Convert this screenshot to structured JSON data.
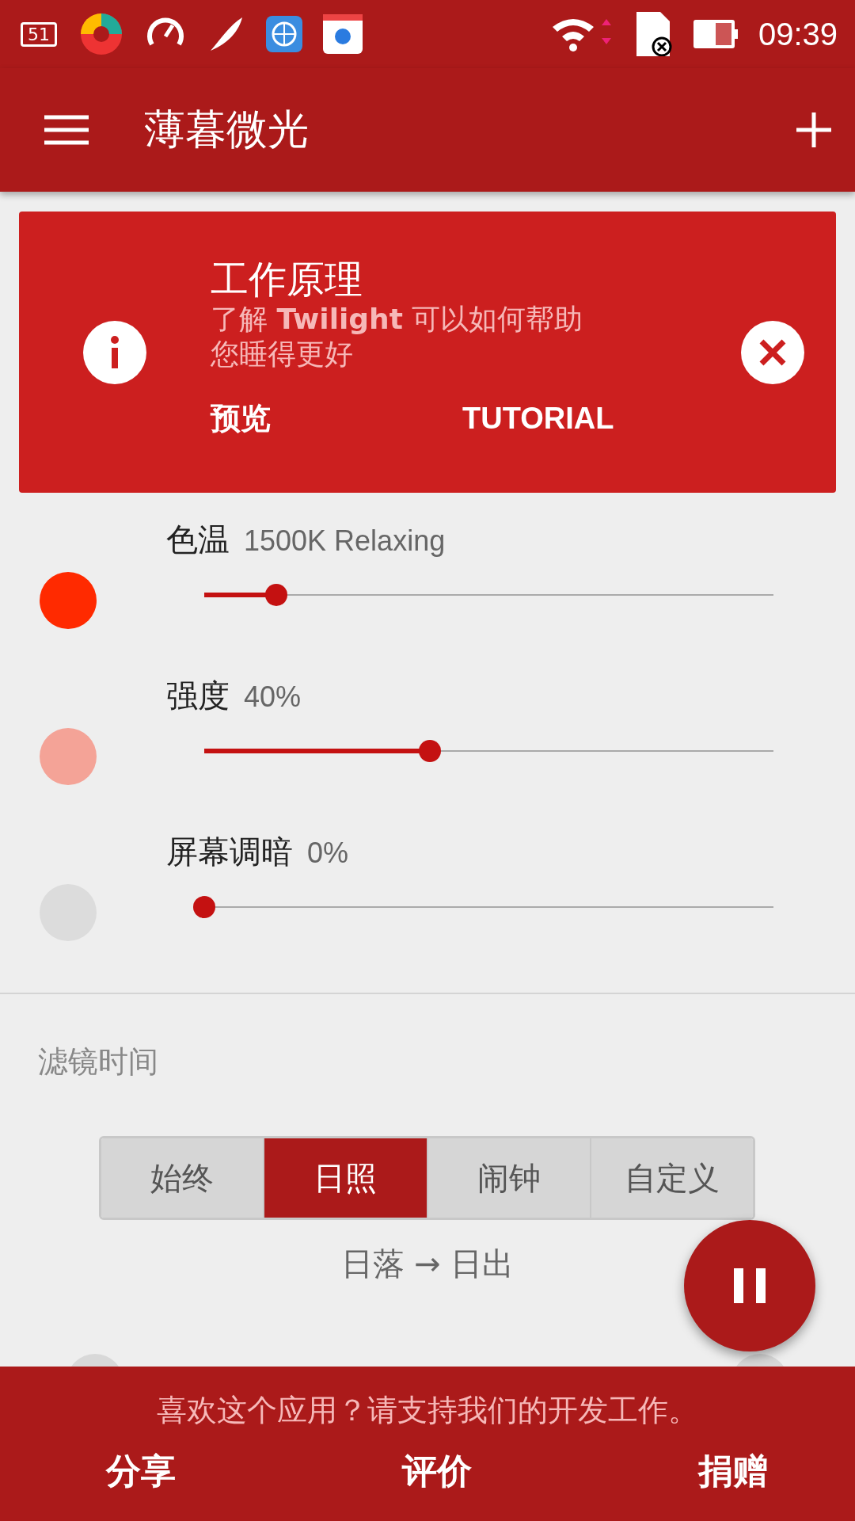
{
  "status_bar": {
    "badge": "51",
    "time": "09:39"
  },
  "app_bar": {
    "title": "薄暮微光"
  },
  "info_card": {
    "title": "工作原理",
    "text": "了解 **Twilight** 可以如何帮助您睡得更好",
    "actions": [
      {
        "label": "预览"
      },
      {
        "label": "TUTORIAL"
      }
    ]
  },
  "sliders": [
    {
      "label": "色温",
      "reading": "1500K Relaxing",
      "level": 0.126,
      "color": "#ff2a00"
    },
    {
      "label": "强度",
      "reading": "40%",
      "level": 0.396,
      "color": "#f4a397"
    },
    {
      "label": "屏幕调暗",
      "reading": "0%",
      "level": 0,
      "color": "#dcdcdc"
    }
  ],
  "filter_time": {
    "heading": "滤镜时间",
    "modes": [
      {
        "label": "始终",
        "selected": false
      },
      {
        "label": "日照",
        "selected": true
      },
      {
        "label": "闹钟",
        "selected": false
      },
      {
        "label": "自定义",
        "selected": false
      }
    ],
    "range": "日落 → 日出"
  },
  "fab": {
    "paused": true
  },
  "footer": {
    "message": "喜欢这个应用？请支持我们的开发工作。",
    "actions": [
      {
        "label": "分享"
      },
      {
        "label": "评价"
      },
      {
        "label": "捐赠"
      }
    ]
  }
}
